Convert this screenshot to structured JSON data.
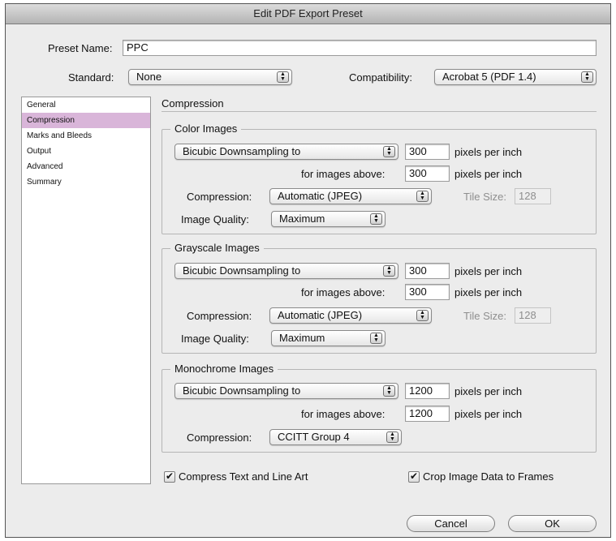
{
  "window": {
    "title": "Edit PDF Export Preset"
  },
  "preset": {
    "label": "Preset Name:",
    "value": "PPC"
  },
  "standard": {
    "label": "Standard:",
    "value": "None"
  },
  "compatibility": {
    "label": "Compatibility:",
    "value": "Acrobat 5 (PDF 1.4)"
  },
  "sidebar": {
    "items": [
      {
        "label": "General"
      },
      {
        "label": "Compression"
      },
      {
        "label": "Marks and Bleeds"
      },
      {
        "label": "Output"
      },
      {
        "label": "Advanced"
      },
      {
        "label": "Summary"
      }
    ],
    "selected": "Compression"
  },
  "section_title": "Compression",
  "color_images": {
    "title": "Color Images",
    "downsampling": "Bicubic Downsampling to",
    "ppi_value": "300",
    "ppi_unit": "pixels per inch",
    "above_label": "for images above:",
    "above_value": "300",
    "above_unit": "pixels per inch",
    "compression_label": "Compression:",
    "compression_value": "Automatic (JPEG)",
    "tile_label": "Tile Size:",
    "tile_value": "128",
    "quality_label": "Image Quality:",
    "quality_value": "Maximum"
  },
  "grayscale_images": {
    "title": "Grayscale Images",
    "downsampling": "Bicubic Downsampling to",
    "ppi_value": "300",
    "ppi_unit": "pixels per inch",
    "above_label": "for images above:",
    "above_value": "300",
    "above_unit": "pixels per inch",
    "compression_label": "Compression:",
    "compression_value": "Automatic (JPEG)",
    "tile_label": "Tile Size:",
    "tile_value": "128",
    "quality_label": "Image Quality:",
    "quality_value": "Maximum"
  },
  "monochrome_images": {
    "title": "Monochrome Images",
    "downsampling": "Bicubic Downsampling to",
    "ppi_value": "1200",
    "ppi_unit": "pixels per inch",
    "above_label": "for images above:",
    "above_value": "1200",
    "above_unit": "pixels per inch",
    "compression_label": "Compression:",
    "compression_value": "CCITT Group 4"
  },
  "options": {
    "compress_text": {
      "label": "Compress Text and Line Art",
      "checked": true
    },
    "crop_image": {
      "label": "Crop Image Data to Frames",
      "checked": true
    }
  },
  "buttons": {
    "cancel": "Cancel",
    "ok": "OK"
  },
  "icons": {
    "checkmark": "✔",
    "stepper_up": "▲",
    "stepper_down": "▼"
  },
  "colors": {
    "selected_item": "#d9b5d9",
    "window_bg": "#ececec"
  }
}
